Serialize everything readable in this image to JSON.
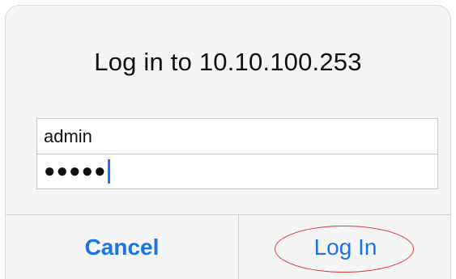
{
  "dialog": {
    "title": "Log in to 10.10.100.253",
    "username": {
      "value": "admin"
    },
    "password": {
      "masked_value": "●●●●●"
    },
    "buttons": {
      "cancel_label": "Cancel",
      "login_label": "Log In"
    }
  },
  "colors": {
    "accent": "#1a73e8",
    "annotation_oval": "#e0313b",
    "caret": "#1f6fff"
  }
}
